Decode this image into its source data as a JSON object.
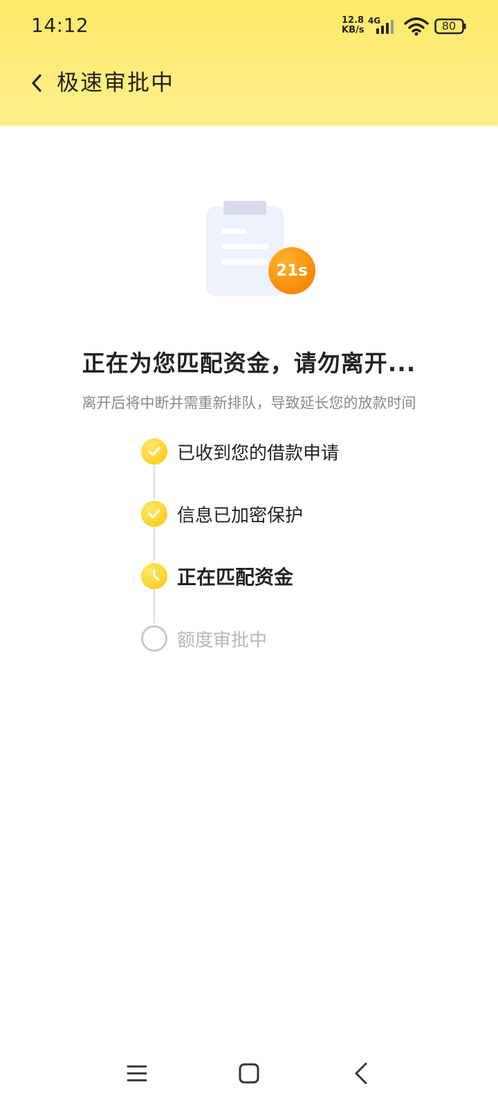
{
  "status_bar": {
    "time": "14:12",
    "net_speed_value": "12.8",
    "net_speed_unit": "KB/s",
    "net_type": "4G",
    "battery": "80",
    "icons": [
      "signal-icon",
      "wifi-icon",
      "battery-icon"
    ]
  },
  "header": {
    "title": "极速审批中",
    "back_icon": "chevron-left-icon"
  },
  "illustration": {
    "icon": "clipboard-icon",
    "timer": "21s"
  },
  "headline": "正在为您匹配资金，请勿离开...",
  "subtext": "离开后将中断并需重新排队，导致延长您的放款时间",
  "steps": [
    {
      "label": "已收到您的借款申请",
      "status": "done",
      "icon": "check-icon"
    },
    {
      "label": "信息已加密保护",
      "status": "done",
      "icon": "check-icon"
    },
    {
      "label": "正在匹配资金",
      "status": "current",
      "icon": "clock-icon"
    },
    {
      "label": "额度审批中",
      "status": "pending",
      "icon": "empty-circle-icon"
    }
  ],
  "nav_bar": {
    "icons": [
      "menu-icon",
      "home-square-icon",
      "back-triangle-icon"
    ]
  },
  "colors": {
    "header_yellow": "#fde968",
    "accent_orange": "#f98a08",
    "step_yellow": "#fdd02a",
    "muted_text": "#888888",
    "pending_text": "#b8b8b8"
  }
}
